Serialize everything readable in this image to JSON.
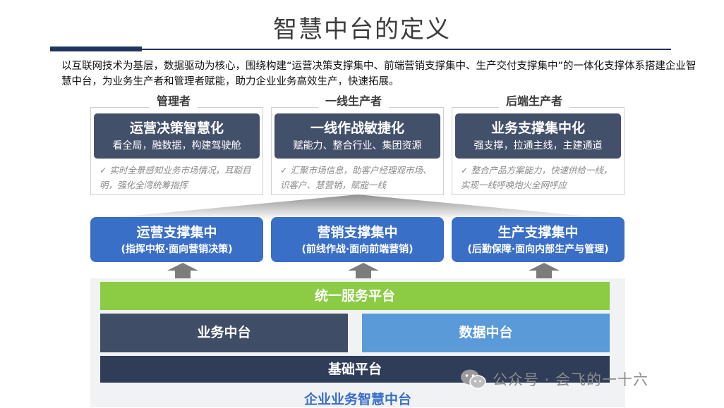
{
  "title": "智慧中台的定义",
  "description": "以互联网技术为基层，数据驱动为核心，围绕构建“运营决策支撑集中、前端营销支撑集中、生产交付支撑集中”的一体化支撑体系搭建企业智慧中台，为业务生产者和管理者赋能，助力企业业务高效生产，快速拓展。",
  "roles": [
    {
      "tag": "管理者",
      "heading": "运营决策智慧化",
      "sub": "看全局，融数据，构建驾驶舱",
      "note": "实时全景感知业务市场情况，耳聪目明，强化全湾统筹指挥"
    },
    {
      "tag": "一线生产者",
      "heading": "一线作战敏捷化",
      "sub": "赋能力、整合行业、集团资源",
      "note": "汇聚市场信息，助客户经理观市场、识客户、慧营销，赋能一线"
    },
    {
      "tag": "后端生产者",
      "heading": "业务支撑集中化",
      "sub": "强支撑，拉通主线，主建通道",
      "note": "整合产品方案能力，快速供给一线，实现一线呼唤炮火全网呼应"
    }
  ],
  "centers": [
    {
      "heading": "运营支撑集中",
      "sub": "(指挥中枢·面向营销决策)"
    },
    {
      "heading": "营销支撑集中",
      "sub": "(前线作战·面向前端营销)"
    },
    {
      "heading": "生产支撑集中",
      "sub": "(后勤保障·面向内部生产与管理)"
    }
  ],
  "platform": {
    "unified": "统一服务平台",
    "business": "业务中台",
    "data": "数据中台",
    "base": "基础平台",
    "footer": "企业业务智慧中台"
  },
  "watermark": "公众号 · 会飞的一十六",
  "colors": {
    "navy": "#1f3560",
    "dark_box": "#43506a",
    "center_blue": "#3a6fc8",
    "green": "#8ccc45",
    "data_blue": "#5b9ad9",
    "base_dark": "#2f3d58"
  }
}
